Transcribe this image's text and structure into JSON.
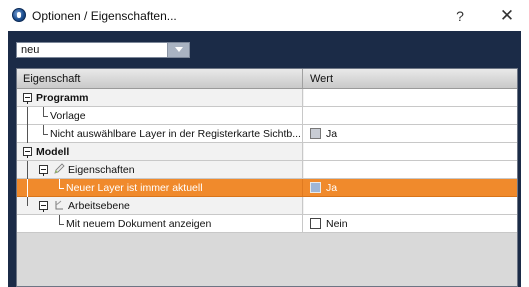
{
  "window": {
    "title": "Optionen / Eigenschaften...",
    "help_label": "?",
    "close_label": "✕",
    "icon": "app-logo-icon"
  },
  "combo": {
    "value": "neu",
    "icon": "chevron-down-icon"
  },
  "grid": {
    "columns": [
      "Eigenschaft",
      "Wert"
    ],
    "rows": [
      {
        "kind": "section",
        "label": "Programm",
        "value": ""
      },
      {
        "kind": "item",
        "label": "Vorlage",
        "value": ""
      },
      {
        "kind": "item",
        "label": "Nicht auswählbare Layer in der Registerkarte Sichtb...",
        "value": "Ja",
        "checkbox": "checked"
      },
      {
        "kind": "section",
        "label": "Modell",
        "value": ""
      },
      {
        "kind": "group",
        "label": "Eigenschaften",
        "value": "",
        "icon": "pencil-icon"
      },
      {
        "kind": "item",
        "label": "Neuer Layer ist immer aktuell",
        "value": "Ja",
        "checkbox": "checked",
        "selected": true
      },
      {
        "kind": "group",
        "label": "Arbeitsebene",
        "value": "",
        "icon": "workplane-icon"
      },
      {
        "kind": "item",
        "label": "Mit neuem Dokument anzeigen",
        "value": "Nein",
        "checkbox": "unchecked"
      }
    ]
  },
  "colors": {
    "frame": "#1b2b47",
    "selection": "#f08a2c"
  }
}
